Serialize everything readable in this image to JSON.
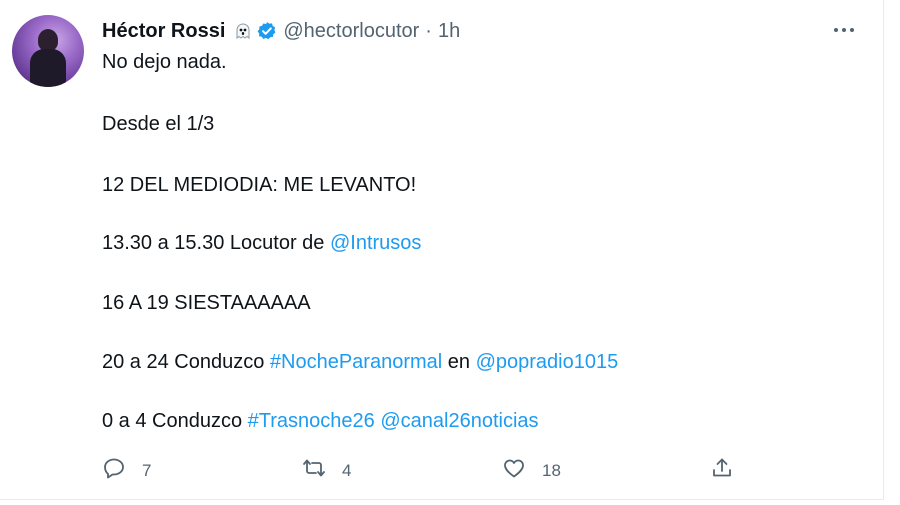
{
  "tweet": {
    "author_name": "Héctor Rossi",
    "handle": "@hectorlocutor",
    "separator": "·",
    "time": "1h",
    "lines": {
      "l1": "No dejo nada.",
      "l2": "Desde el 1/3",
      "l3": "12 DEL MEDIODIA: ME LEVANTO!",
      "l4_text": "13.30 a 15.30 Locutor de ",
      "l4_mention": "@Intrusos",
      "l5": "16 A 19 SIESTAAAAAA",
      "l6_text": "20 a 24 Conduzco ",
      "l6_hashtag": "#NocheParanormal",
      "l6_text2": " en ",
      "l6_mention": "@popradio1015",
      "l7_text": "0 a 4 Conduzco ",
      "l7_hashtag": "#Trasnoche26",
      "l7_space": " ",
      "l7_mention": "@canal26noticias"
    },
    "icons": {
      "badge": "ghost-icon",
      "verified": "verified-badge-icon",
      "more": "more-dots-icon",
      "reply": "reply-icon",
      "retweet": "retweet-icon",
      "like": "like-icon",
      "share": "share-icon"
    },
    "stats": {
      "replies": "7",
      "retweets": "4",
      "likes": "18"
    },
    "colors": {
      "link": "#1d9bf0",
      "secondary_text": "#536471",
      "verified": "#1d9bf0"
    }
  }
}
